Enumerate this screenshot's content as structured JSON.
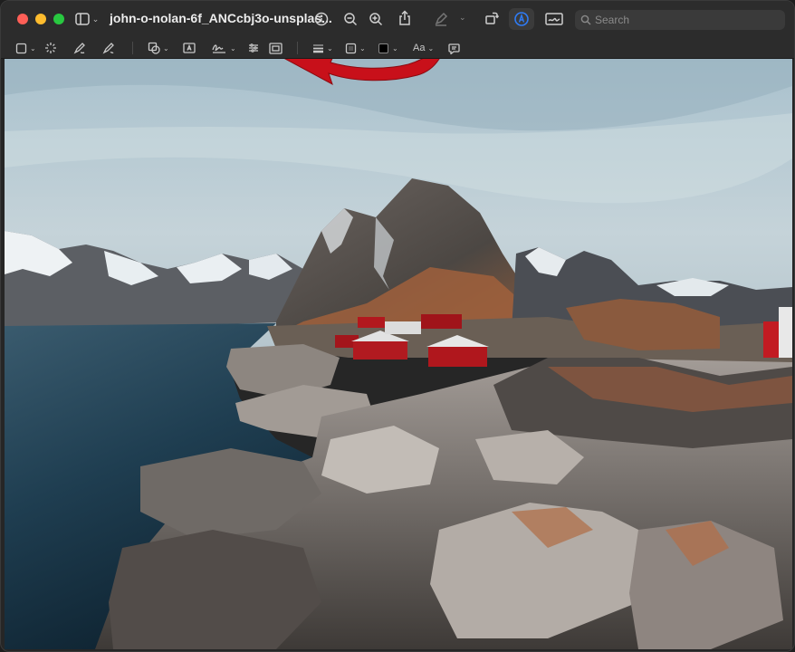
{
  "window": {
    "title": "john-o-nolan-6f_ANCcbj3o-unsplas..."
  },
  "titlebar": {
    "sidebar_toggle": "sidebar-icon",
    "info": "info-icon",
    "zoom_out": "zoom-out-icon",
    "zoom_in": "zoom-in-icon",
    "share": "share-icon",
    "highlight": "highlighter-icon",
    "rotate": "rotate-icon",
    "markup": "markup-icon",
    "sign": "signature-icon"
  },
  "search": {
    "placeholder": "Search"
  },
  "markup_toolbar": {
    "tools": [
      "selection-icon",
      "instant-alpha-icon",
      "sketch-icon",
      "draw-icon",
      "shapes-icon",
      "text-box-icon",
      "sign-icon",
      "adjust-color-icon",
      "adjust-size-icon",
      "shape-style-icon",
      "border-color-icon",
      "fill-color-icon",
      "text-style-icon",
      "speech-bubble-icon"
    ],
    "text_style_label": "Aa"
  },
  "colors": {
    "accent": "#2f7cf6",
    "annotation_arrow": "#c8101a",
    "fill_swatch": "#000000"
  },
  "image": {
    "subject": "photo"
  }
}
